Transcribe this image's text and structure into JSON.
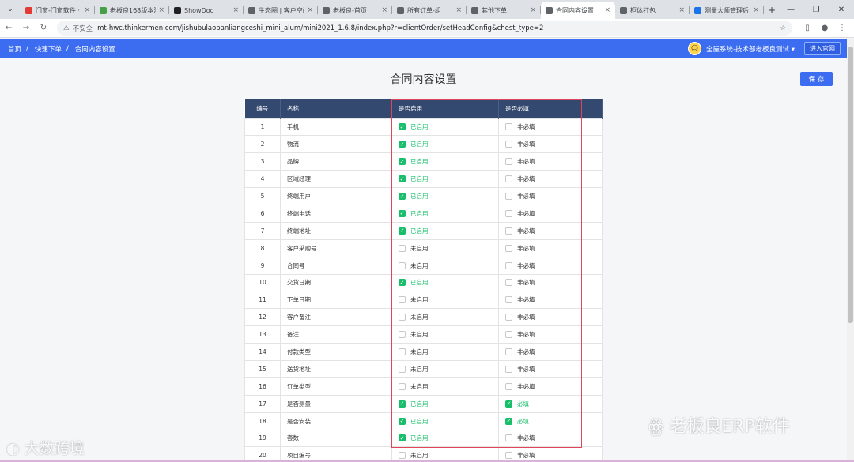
{
  "browser": {
    "tabs": [
      {
        "title": "门窗-门窗软件 · 下",
        "color": "#e53935",
        "active": false
      },
      {
        "title": "老板良168版本测",
        "color": "#43a047",
        "active": false
      },
      {
        "title": "ShowDoc",
        "color": "#202124",
        "active": false
      },
      {
        "title": "生态圈 | 客户空间",
        "color": "#5f6368",
        "active": false
      },
      {
        "title": "老板良-首页",
        "color": "#5f6368",
        "active": false
      },
      {
        "title": "所有订单-组",
        "color": "#5f6368",
        "active": false
      },
      {
        "title": "其他下单",
        "color": "#5f6368",
        "active": false
      },
      {
        "title": "合同内容设置",
        "color": "#5f6368",
        "active": true
      },
      {
        "title": "柜体打包",
        "color": "#5f6368",
        "active": false
      },
      {
        "title": "测量大师管理后台",
        "color": "#1a73e8",
        "active": false
      }
    ],
    "insecure_label": "不安全",
    "url": "mt-hwc.thinkermen.com/jishubulaobanliangceshi_mini_alum/mini2021_1.6.8/index.php?r=clientOrder/setHeadConfig&chest_type=2"
  },
  "header": {
    "breadcrumb": [
      "首页",
      "快速下单",
      "合同内容设置"
    ],
    "user": "全屋系统-技术部老板良测试",
    "enter_label": "进入官网"
  },
  "page": {
    "title": "合同内容设置",
    "save_label": "保 存"
  },
  "table": {
    "headers": [
      "编号",
      "名称",
      "是否启用",
      "是否必填"
    ],
    "enabled_on_label": "已启用",
    "enabled_off_label": "未启用",
    "required_on_label": "必填",
    "required_off_label": "非必填",
    "rows": [
      {
        "num": "1",
        "name": "手机",
        "enabled": true,
        "required": false
      },
      {
        "num": "2",
        "name": "物流",
        "enabled": true,
        "required": false
      },
      {
        "num": "3",
        "name": "品牌",
        "enabled": true,
        "required": false
      },
      {
        "num": "4",
        "name": "区域经理",
        "enabled": true,
        "required": false
      },
      {
        "num": "5",
        "name": "终端用户",
        "enabled": true,
        "required": false
      },
      {
        "num": "6",
        "name": "终端电话",
        "enabled": true,
        "required": false
      },
      {
        "num": "7",
        "name": "终端地址",
        "enabled": true,
        "required": false
      },
      {
        "num": "8",
        "name": "客户采购号",
        "enabled": false,
        "required": false
      },
      {
        "num": "9",
        "name": "合同号",
        "enabled": false,
        "required": false
      },
      {
        "num": "10",
        "name": "交货日期",
        "enabled": true,
        "required": false
      },
      {
        "num": "11",
        "name": "下单日期",
        "enabled": false,
        "required": false
      },
      {
        "num": "12",
        "name": "客户备注",
        "enabled": false,
        "required": false
      },
      {
        "num": "13",
        "name": "备注",
        "enabled": false,
        "required": false
      },
      {
        "num": "14",
        "name": "付款类型",
        "enabled": false,
        "required": false
      },
      {
        "num": "15",
        "name": "送货地址",
        "enabled": false,
        "required": false
      },
      {
        "num": "16",
        "name": "订单类型",
        "enabled": false,
        "required": false
      },
      {
        "num": "17",
        "name": "是否测量",
        "enabled": true,
        "required": true
      },
      {
        "num": "18",
        "name": "是否安装",
        "enabled": true,
        "required": true
      },
      {
        "num": "19",
        "name": "套数",
        "enabled": true,
        "required": false
      },
      {
        "num": "20",
        "name": "项目编号",
        "enabled": false,
        "required": false
      }
    ]
  },
  "watermark": {
    "text": "老板良ERP软件",
    "text2": "大数跨境"
  },
  "colors": {
    "brand_blue": "#3c6df0",
    "table_header": "#34496f",
    "check_green": "#19be6b",
    "highlight_red": "#e0455a"
  }
}
